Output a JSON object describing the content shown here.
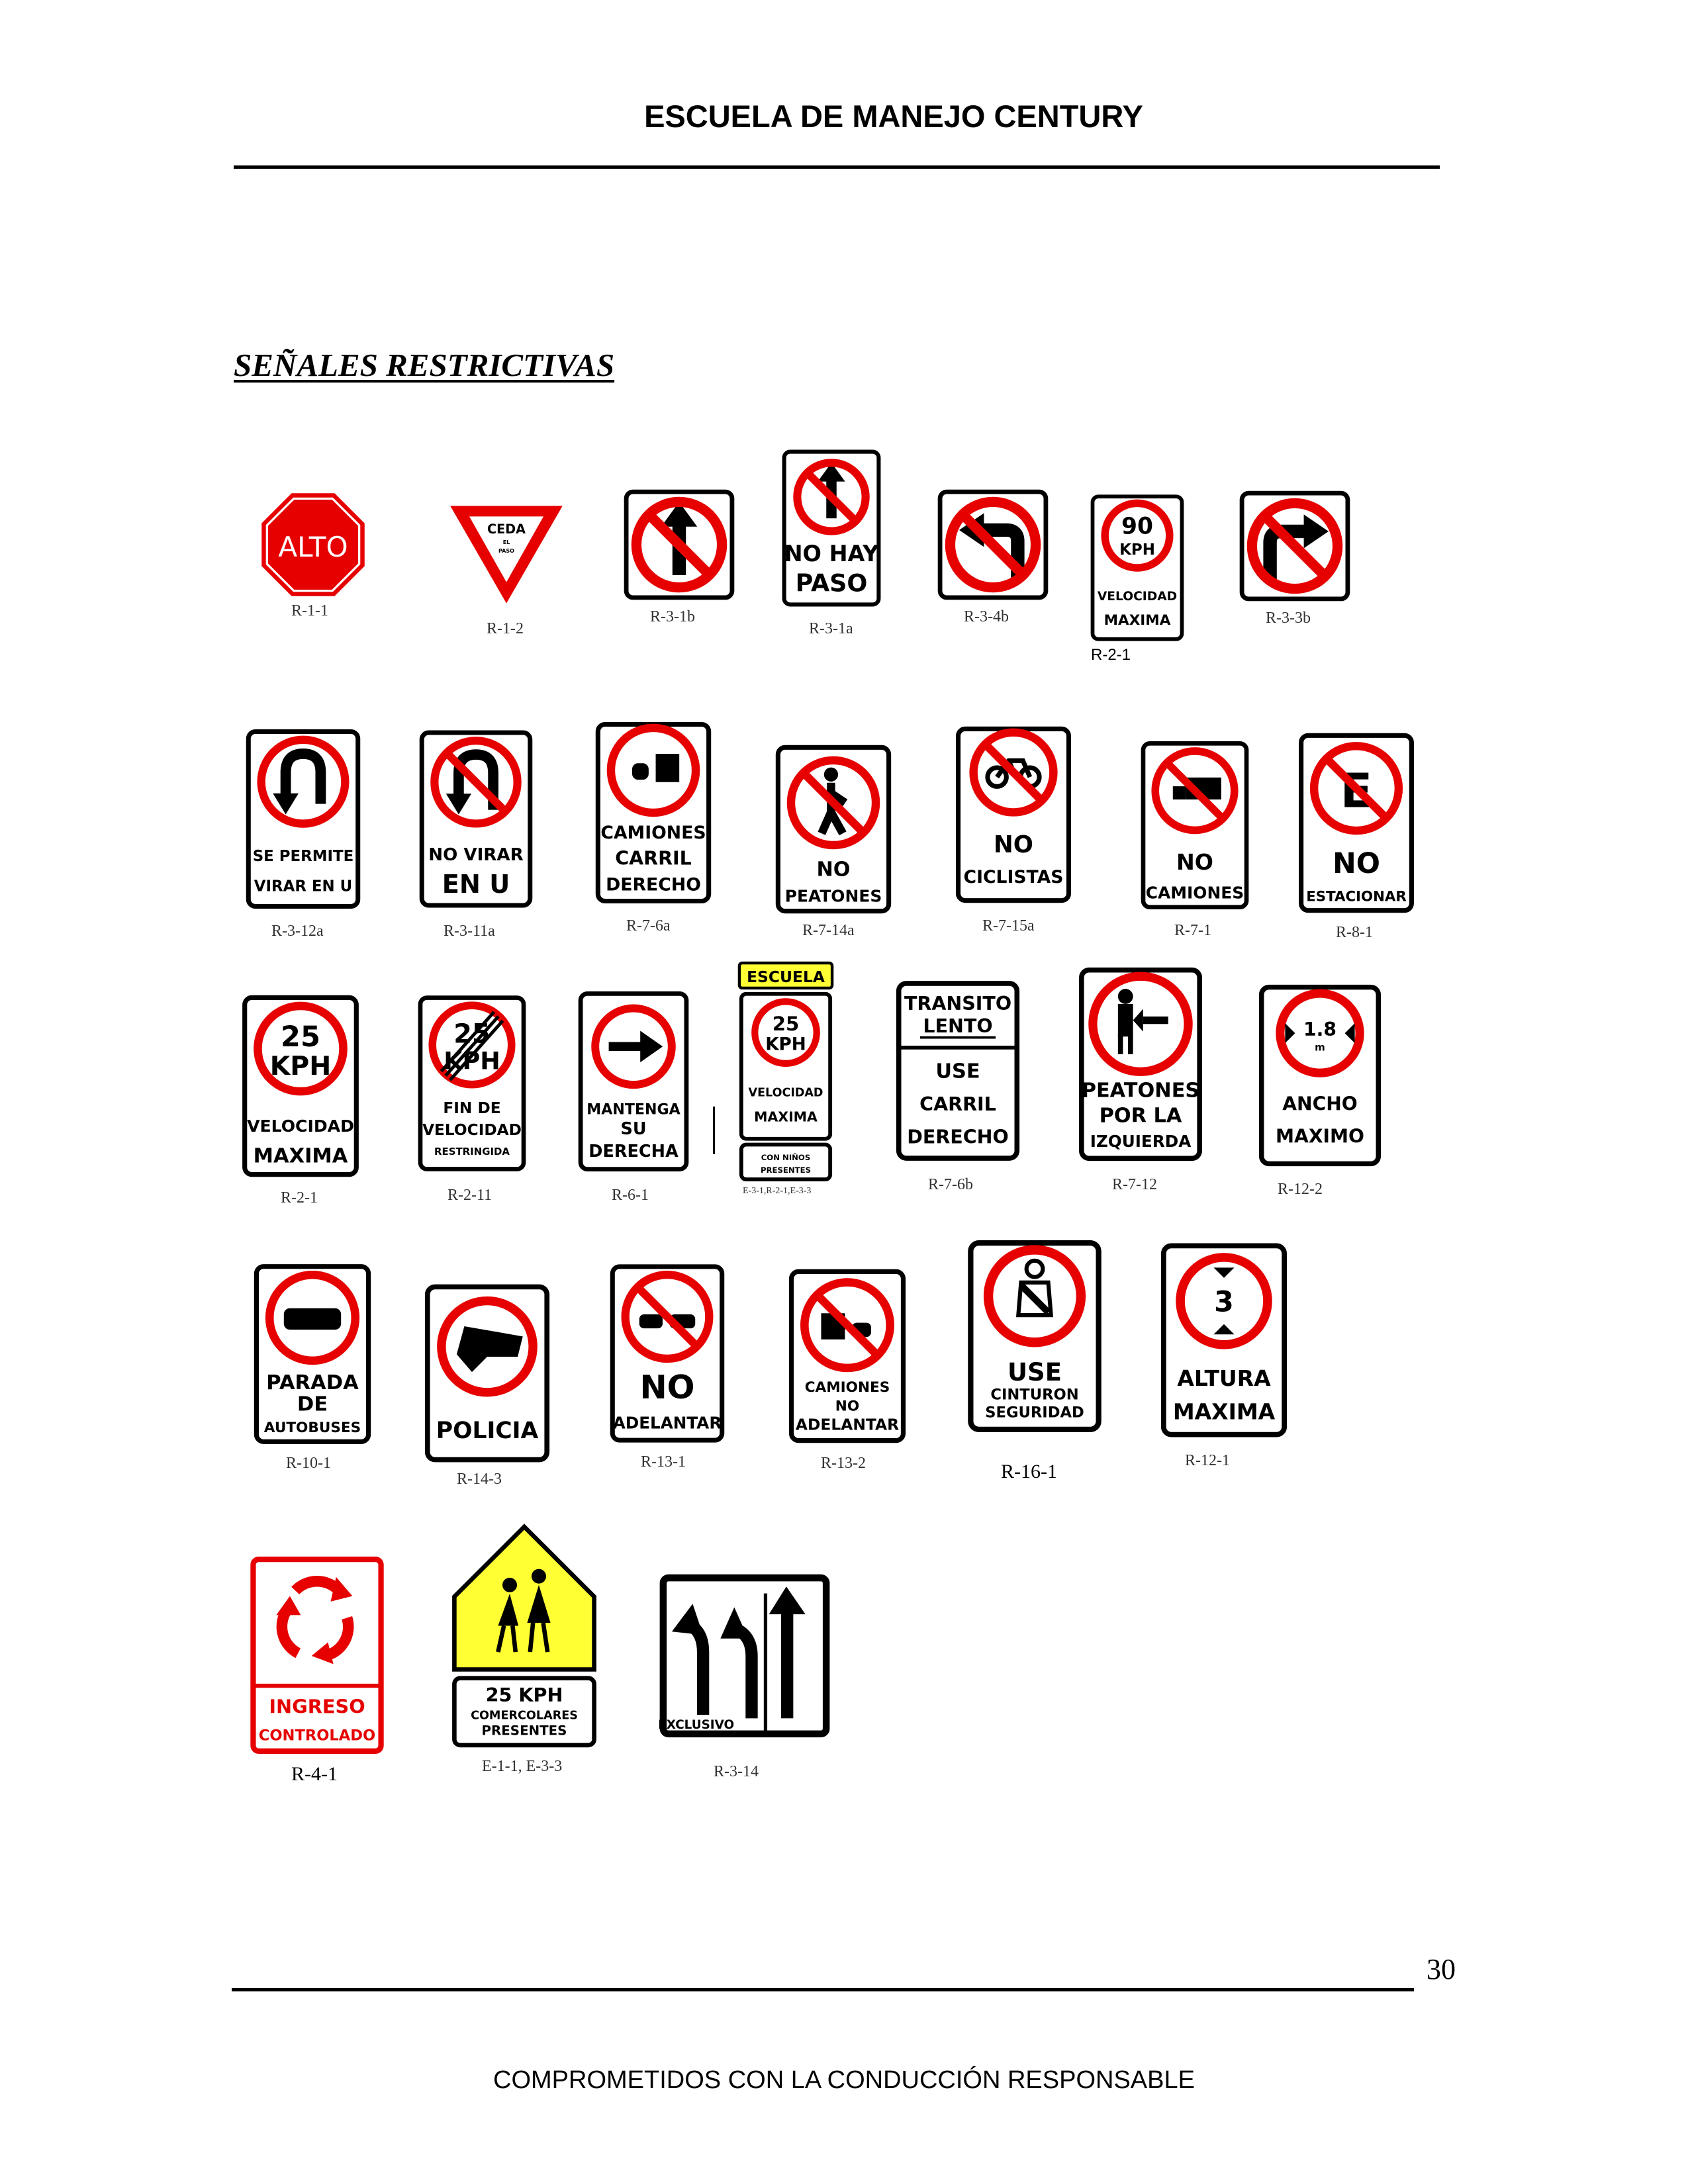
{
  "header": {
    "title": "ESCUELA DE MANEJO CENTURY"
  },
  "section": {
    "title": "SEÑALES RESTRICTIVAS"
  },
  "signs": {
    "alto": {
      "text": "ALTO",
      "code": "R-1-1"
    },
    "ceda": {
      "text1": "CEDA",
      "text2": "EL",
      "text3": "PASO",
      "code": "R-1-2"
    },
    "r31b": {
      "code": "R-3-1b"
    },
    "r31a": {
      "text1": "NO HAY",
      "text2": "PASO",
      "code": "R-3-1a"
    },
    "r34b": {
      "code": "R-3-4b"
    },
    "r21a": {
      "num": "90",
      "unit": "KPH",
      "text1": "VELOCIDAD",
      "text2": "MAXIMA",
      "code": "R-2-1"
    },
    "r33b": {
      "code": "R-3-3b"
    },
    "r312a": {
      "text1": "SE PERMITE",
      "text2": "VIRAR EN U",
      "code": "R-3-12a"
    },
    "r311a": {
      "text1": "NO VIRAR",
      "text2": "EN U",
      "code": "R-3-11a"
    },
    "r76a": {
      "text1": "CAMIONES",
      "text2": "CARRIL",
      "text3": "DERECHO",
      "code": "R-7-6a"
    },
    "r714a": {
      "text1": "NO",
      "text2": "PEATONES",
      "code": "R-7-14a"
    },
    "r715a": {
      "text1": "NO",
      "text2": "CICLISTAS",
      "code": "R-7-15a"
    },
    "r71": {
      "text1": "NO",
      "text2": "CAMIONES",
      "code": "R-7-1"
    },
    "r81": {
      "letter": "E",
      "text1": "NO",
      "text2": "ESTACIONAR",
      "code": "R-8-1"
    },
    "r21b": {
      "num": "25",
      "unit": "KPH",
      "text1": "VELOCIDAD",
      "text2": "MAXIMA",
      "code": "R-2-1"
    },
    "r211": {
      "num": "25",
      "unit": "KPH",
      "text1": "FIN DE",
      "text2": "VELOCIDAD",
      "text3": "RESTRINGIDA",
      "code": "R-2-11"
    },
    "r61": {
      "text1": "MANTENGA",
      "text2": "SU",
      "text3": "DERECHA",
      "code": "R-6-1"
    },
    "escuela": {
      "plate": "ESCUELA",
      "num": "25",
      "unit": "KPH",
      "text1": "VELOCIDAD",
      "text2": "MAXIMA",
      "text3": "CON NIÑOS",
      "text4": "PRESENTES",
      "code": "E-3-1,R-2-1,E-3-3"
    },
    "r76b": {
      "text1": "TRANSITO",
      "text2": "LENTO",
      "text3": "USE",
      "text4": "CARRIL",
      "text5": "DERECHO",
      "code": "R-7-6b"
    },
    "r712": {
      "text1": "PEATONES",
      "text2": "POR LA",
      "text3": "IZQUIERDA",
      "code": "R-7-12"
    },
    "r122": {
      "num": "1.8",
      "unit": "m",
      "text1": "ANCHO",
      "text2": "MAXIMO",
      "code": "R-12-2"
    },
    "r101": {
      "text1": "PARADA",
      "text2": "DE",
      "text3": "AUTOBUSES",
      "code": "R-10-1"
    },
    "r143": {
      "text1": "POLICIA",
      "code": "R-14-3"
    },
    "r131": {
      "text1": "NO",
      "text2": "ADELANTAR",
      "code": "R-13-1"
    },
    "r132": {
      "text1": "CAMIONES",
      "text2": "NO",
      "text3": "ADELANTAR",
      "code": "R-13-2"
    },
    "r161": {
      "text1": "USE",
      "text2": "CINTURON",
      "text3": "SEGURIDAD",
      "code": "R-16-1"
    },
    "r121": {
      "num": "3",
      "text1": "ALTURA",
      "text2": "MAXIMA",
      "code": "R-12-1"
    },
    "r41": {
      "text1": "INGRESO",
      "text2": "CONTROLADO",
      "code": "R-4-1"
    },
    "e11": {
      "text1": "25 KPH",
      "text2": "COMERCOLARES",
      "text3": "PRESENTES",
      "code": "E-1-1, E-3-3"
    },
    "r314": {
      "text1": "EXCLUSIVO",
      "code": "R-3-14"
    }
  },
  "page_number": "30",
  "footer": {
    "text": "COMPROMETIDOS CON LA CONDUCCIÓN RESPONSABLE"
  },
  "colors": {
    "red": "#e60000",
    "yellow": "#ffff33",
    "black": "#000000"
  }
}
